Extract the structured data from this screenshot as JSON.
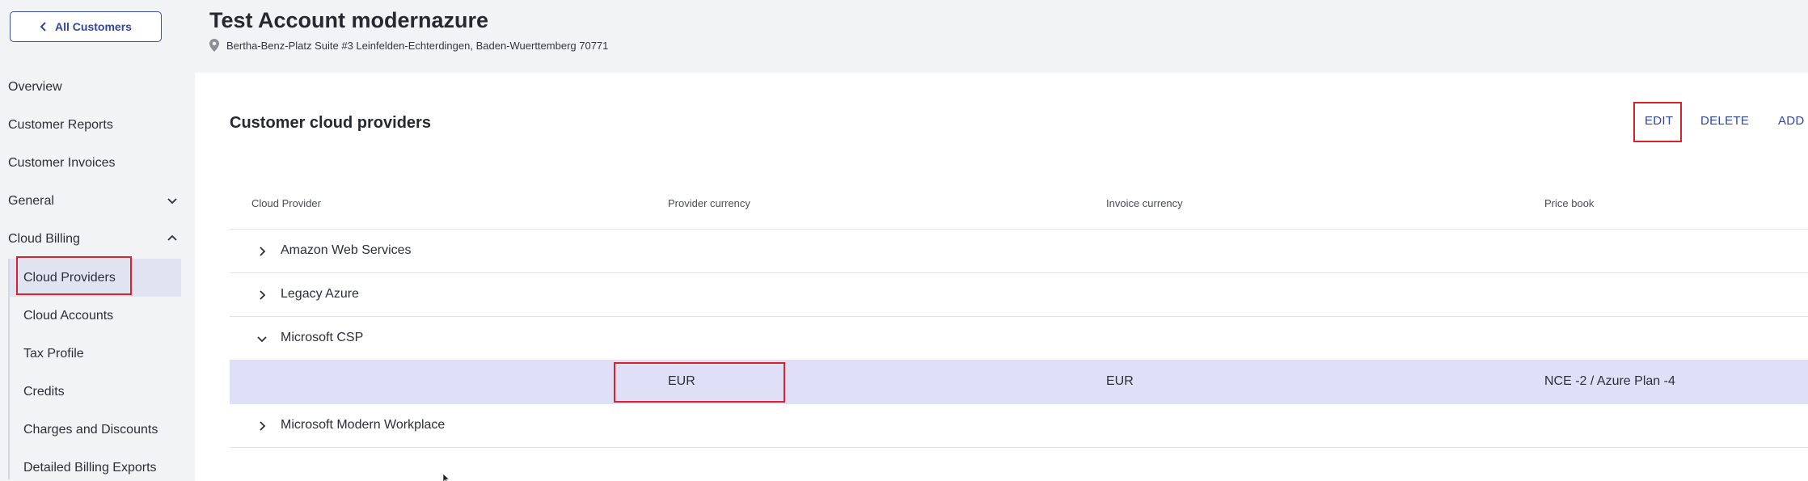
{
  "sidebar": {
    "back_label": "All Customers",
    "nav": [
      {
        "label": "Overview"
      },
      {
        "label": "Customer Reports"
      },
      {
        "label": "Customer Invoices"
      },
      {
        "label": "General",
        "state": "collapsed"
      },
      {
        "label": "Cloud Billing",
        "state": "expanded"
      }
    ],
    "sub_items": [
      {
        "label": "Cloud Providers",
        "active": true
      },
      {
        "label": "Cloud Accounts"
      },
      {
        "label": "Tax Profile"
      },
      {
        "label": "Credits"
      },
      {
        "label": "Charges and Discounts"
      },
      {
        "label": "Detailed Billing Exports"
      }
    ]
  },
  "header": {
    "title": "Test Account modernazure",
    "address": "Bertha-Benz-Platz Suite #3 Leinfelden-Echterdingen, Baden-Wuerttemberg 70771"
  },
  "main": {
    "title": "Customer cloud providers",
    "actions": {
      "edit": "EDIT",
      "delete": "DELETE",
      "add": "ADD"
    },
    "table": {
      "columns": [
        "Cloud Provider",
        "Provider currency",
        "Invoice currency",
        "Price book"
      ],
      "rows": [
        {
          "provider": "Amazon Web Services",
          "expanded": false
        },
        {
          "provider": "Legacy Azure",
          "expanded": false
        },
        {
          "provider": "Microsoft CSP",
          "expanded": true
        },
        {
          "provider": "",
          "provider_currency": "EUR",
          "invoice_currency": "EUR",
          "price_book": "NCE -2 / Azure Plan -4"
        },
        {
          "provider": "Microsoft Modern Workplace",
          "expanded": false
        }
      ]
    }
  },
  "colors": {
    "accent": "#3046a6",
    "highlight": "#d9212b",
    "selected_row": "#dfe0f8",
    "active_nav": "#dfe4f0"
  }
}
